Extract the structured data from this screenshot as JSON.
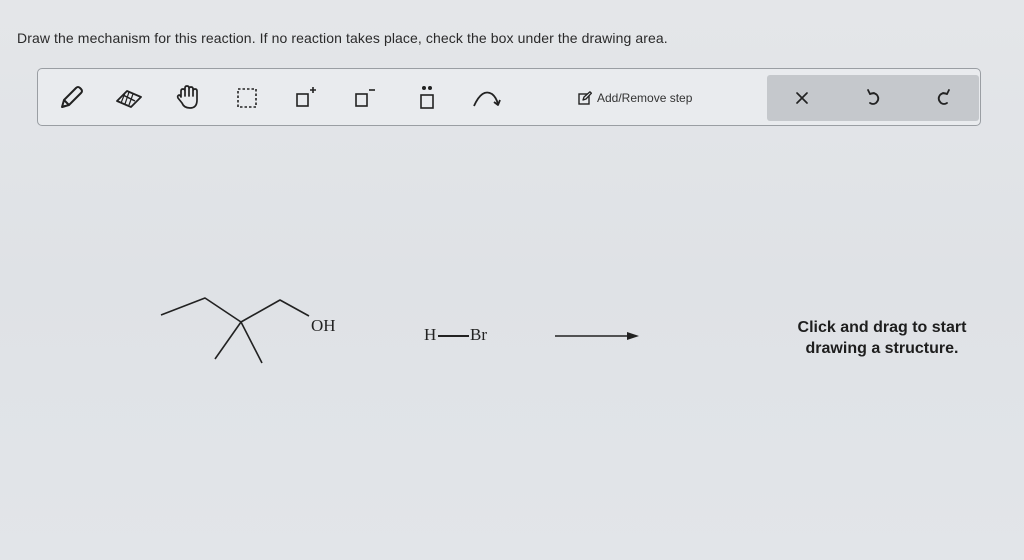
{
  "instruction": "Draw the mechanism for this reaction. If no reaction takes place, check the box under the drawing area.",
  "toolbar": {
    "tools": [
      {
        "name": "pencil-icon"
      },
      {
        "name": "eraser-icon"
      },
      {
        "name": "hand-icon"
      },
      {
        "name": "selection-box-icon"
      },
      {
        "name": "add-positive-charge-icon",
        "label": "+"
      },
      {
        "name": "add-negative-charge-icon",
        "label": "−"
      },
      {
        "name": "add-lone-pair-icon",
        "label": "••"
      },
      {
        "name": "curved-arrow-icon"
      }
    ],
    "add_remove_step_label": "Add/Remove step",
    "actions": [
      {
        "name": "clear-icon"
      },
      {
        "name": "undo-icon"
      },
      {
        "name": "redo-icon"
      }
    ]
  },
  "canvas": {
    "oh_label": "OH",
    "h_label": "H",
    "br_label": "Br",
    "hint_line1": "Click and drag to start",
    "hint_line2": "drawing a structure."
  }
}
